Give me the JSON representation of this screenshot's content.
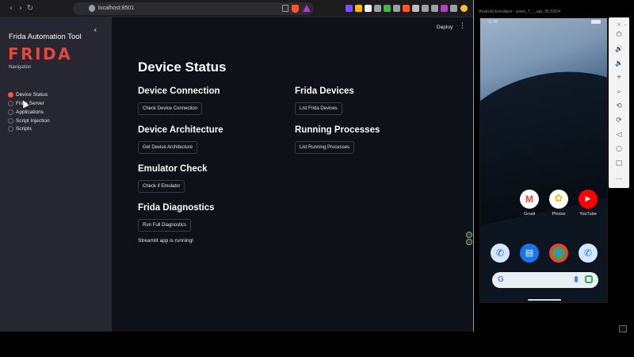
{
  "browser": {
    "url": "localhost:8501",
    "nav": {
      "back": "‹",
      "forward": "›",
      "reload": "↻",
      "bookmark": "☐"
    }
  },
  "sidebar": {
    "collapse_icon": "‹",
    "app_title": "Frida Automation Tool",
    "logo": "FRIDA",
    "nav_label": "Navigation",
    "items": [
      {
        "label": "Device Status",
        "selected": true
      },
      {
        "label": "Frida Server",
        "selected": false
      },
      {
        "label": "Applications",
        "selected": false
      },
      {
        "label": "Script Injection",
        "selected": false
      },
      {
        "label": "Scripts",
        "selected": false
      }
    ]
  },
  "header": {
    "deploy": "Deploy",
    "menu": "⋮"
  },
  "main": {
    "title": "Device Status",
    "sections": [
      {
        "heading": "Device Connection",
        "button": "Check Device Connection"
      },
      {
        "heading": "Frida Devices",
        "button": "List Frida Devices"
      },
      {
        "heading": "Device Architecture",
        "button": "Get Device Architecture"
      },
      {
        "heading": "Running Processes",
        "button": "List Running Processes"
      },
      {
        "heading": "Emulator Check",
        "button": "Check if Emulator"
      },
      {
        "heading": "Frida Diagnostics",
        "button": "Run Full Diagnostics"
      }
    ],
    "status": "Streamlit app is running!"
  },
  "emulator": {
    "title": "Android Emulator - pixel_7_-_api_35:5554",
    "clock": "11:55",
    "apps_row1": [
      {
        "label": "Gmail",
        "color": "#ffffff",
        "glyph": "M",
        "glyph_color": "#ea4335"
      },
      {
        "label": "Photos",
        "color": "#ffffff",
        "glyph": "✿",
        "glyph_color": "#fbbc04"
      },
      {
        "label": "YouTube",
        "color": "#ff0000",
        "glyph": "▶",
        "glyph_color": "#ffffff"
      }
    ],
    "dock": [
      {
        "name": "phone",
        "color": "#d6e6ff",
        "glyph": "✆",
        "glyph_color": "#1a5fb4"
      },
      {
        "name": "messages",
        "color": "#1a73e8",
        "glyph": "▤",
        "glyph_color": "#ffffff"
      },
      {
        "name": "chrome",
        "color": "#34a853",
        "glyph": "●",
        "glyph_color": "#4285f4"
      },
      {
        "name": "dialer",
        "color": "#d6e6ff",
        "glyph": "✆",
        "glyph_color": "#1a73e8"
      }
    ],
    "search_glyph": "G",
    "controls": [
      "⏻",
      "🔊",
      "🔉",
      "⌖",
      "⌕",
      "⟲",
      "⟳",
      "◁",
      "○",
      "□",
      "…"
    ]
  }
}
